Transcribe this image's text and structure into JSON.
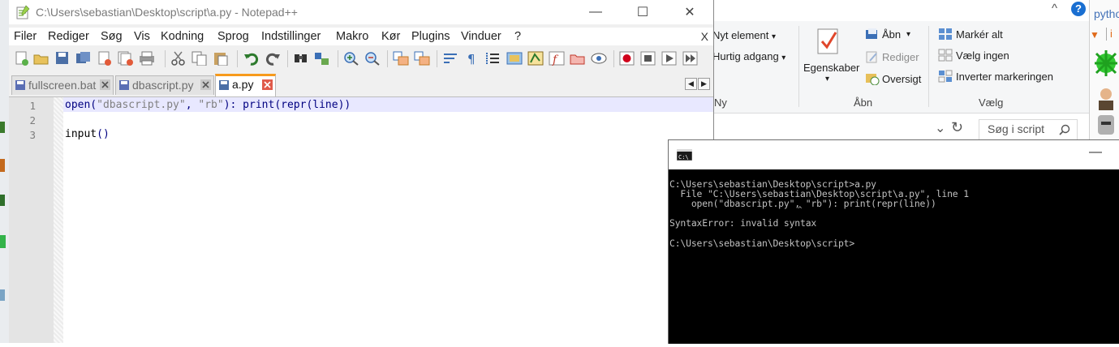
{
  "notepad": {
    "title": "C:\\Users\\sebastian\\Desktop\\script\\a.py - Notepad++",
    "window_buttons": {
      "minimize": "—",
      "maximize": "☐",
      "close": "✕"
    },
    "menu": [
      "Filer",
      "Rediger",
      "Søg",
      "Vis",
      "Kodning",
      "Sprog",
      "Indstillinger",
      "Makro",
      "Kør",
      "Plugins",
      "Vinduer",
      "?"
    ],
    "close_doc": "X",
    "tabs": [
      {
        "label": "fullscreen.bat",
        "active": false
      },
      {
        "label": "dbascript.py",
        "active": false
      },
      {
        "label": "a.py",
        "active": true
      }
    ],
    "tab_nav": {
      "left": "◀",
      "right": "▶"
    },
    "line_numbers": [
      "1",
      "2",
      "3"
    ],
    "code": {
      "line1": {
        "t1": "open(",
        "t2": "\"dbascript.py\"",
        "t3": ", ",
        "t4": "\"rb\"",
        "t5": "): ",
        "t6": "print",
        "t7": "(",
        "t8": "repr",
        "t9": "(line))"
      },
      "line3": {
        "t1": "input",
        "t2": "()"
      }
    }
  },
  "explorer": {
    "ribbon": {
      "ny_element": "Nyt element",
      "hurtig_adgang": "Hurtig adgang",
      "ny_group": "Ny",
      "egenskaber": "Egenskaber",
      "abn": "Åbn",
      "rediger": "Rediger",
      "oversigt": "Oversigt",
      "abn_group": "Åbn",
      "marker_alt": "Markér alt",
      "vaelg_ingen": "Vælg ingen",
      "inverter": "Inverter markeringen",
      "vaelg_group": "Vælg",
      "dropdown": "▾",
      "help": "?",
      "collapse": "^"
    },
    "search_placeholder": "Søg i script",
    "strip_text": "pytho"
  },
  "console": {
    "lines": [
      "C:\\Users\\sebastian\\Desktop\\script>a.py",
      "  File \"C:\\Users\\sebastian\\Desktop\\script\\a.py\", line 1",
      "    open(\"dbascript.py\", \"rb\"): print(repr(line))",
      "                              ^",
      "SyntaxError: invalid syntax",
      "C:\\Users\\sebastian\\Desktop\\script>"
    ],
    "minimize": "—"
  },
  "colors": {
    "keyword": "#000080",
    "string": "#808080",
    "active_tab_accent": "#f79a1c",
    "current_line": "#e8e8ff",
    "console_bg": "#000000",
    "console_text": "#c0c0c0"
  }
}
